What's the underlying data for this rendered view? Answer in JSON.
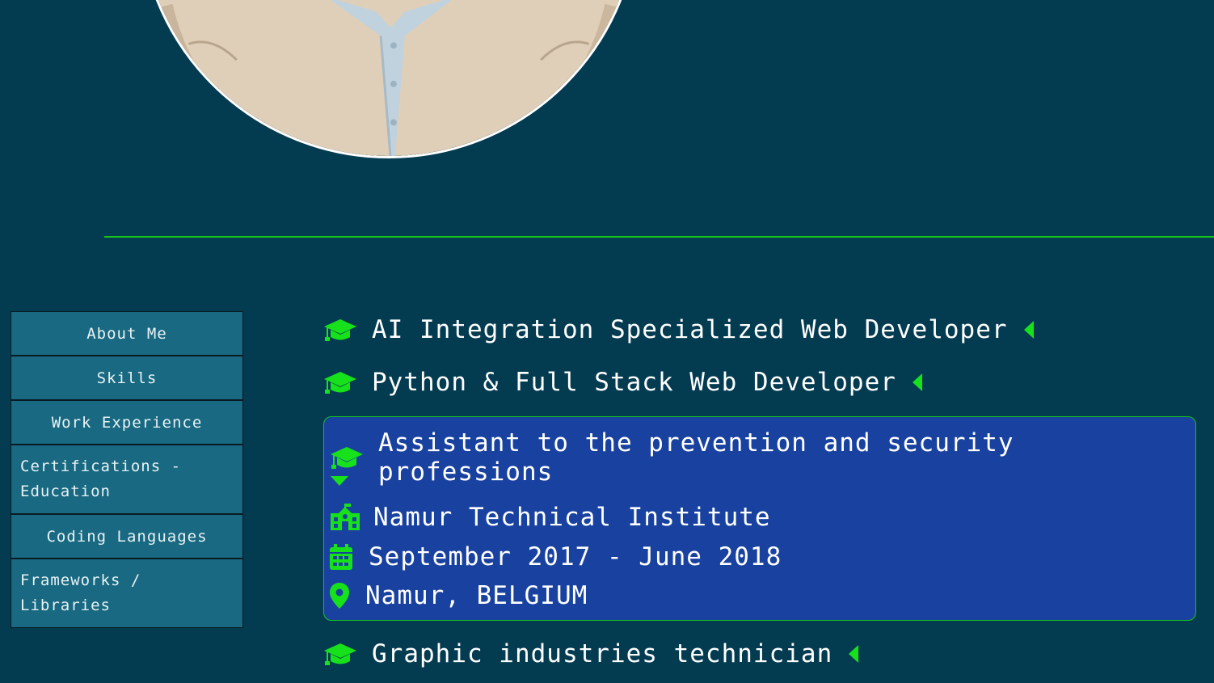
{
  "profile": {
    "avatar_icon": "profile-photo"
  },
  "nav": {
    "items": [
      {
        "label": "About Me"
      },
      {
        "label": "Skills"
      },
      {
        "label": "Work Experience"
      },
      {
        "label": "Certifications - Education"
      },
      {
        "label": "Coding Languages"
      },
      {
        "label": "Frameworks / Libraries"
      }
    ]
  },
  "education": {
    "items": [
      {
        "title": "AI Integration Specialized Web Developer",
        "expanded": false
      },
      {
        "title": "Python & Full Stack Web Developer",
        "expanded": false
      },
      {
        "title": "Assistant to the prevention and security professions",
        "expanded": true,
        "school": "Namur Technical Institute",
        "dates": "September 2017 - June 2018",
        "location": "Namur, BELGIUM"
      },
      {
        "title": "Graphic industries technician",
        "expanded": false
      }
    ]
  },
  "colors": {
    "background": "#033b51",
    "accent_green": "#17c21a",
    "nav_bg": "#186981",
    "card_bg": "#1942a0"
  },
  "icons": {
    "item": "graduation-cap-icon",
    "collapsed": "caret-left-icon",
    "expanded": "caret-down-icon",
    "school": "school-icon",
    "dates": "calendar-icon",
    "location": "map-pin-icon"
  }
}
